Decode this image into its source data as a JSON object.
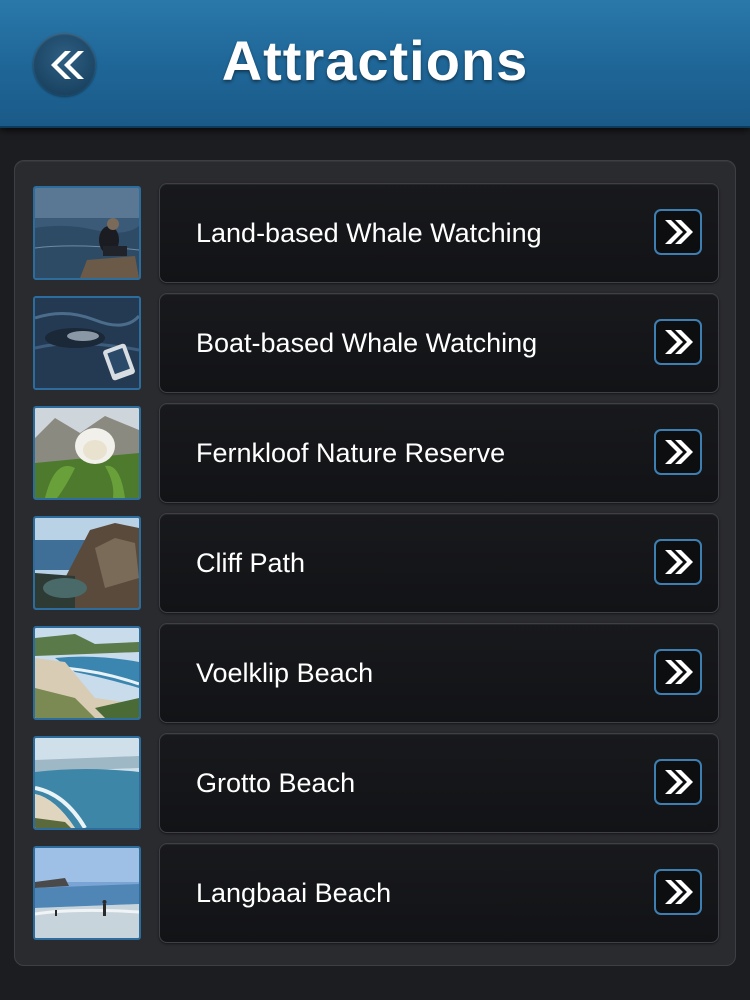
{
  "header": {
    "title": "Attractions",
    "back_icon": "double-chevron-left-icon"
  },
  "attractions": [
    {
      "label": "Land-based Whale Watching",
      "thumb": "person-on-rocks-ocean",
      "icon": "double-chevron-right-icon"
    },
    {
      "label": "Boat-based Whale Watching",
      "thumb": "whale-in-sea",
      "icon": "double-chevron-right-icon"
    },
    {
      "label": "Fernkloof Nature Reserve",
      "thumb": "protea-flower",
      "icon": "double-chevron-right-icon"
    },
    {
      "label": "Cliff Path",
      "thumb": "coastal-cliffs",
      "icon": "double-chevron-right-icon"
    },
    {
      "label": "Voelklip Beach",
      "thumb": "beach-with-dunes",
      "icon": "double-chevron-right-icon"
    },
    {
      "label": "Grotto Beach",
      "thumb": "long-beach-aerial",
      "icon": "double-chevron-right-icon"
    },
    {
      "label": "Langbaai Beach",
      "thumb": "beach-with-swimmers",
      "icon": "double-chevron-right-icon"
    }
  ],
  "colors": {
    "header": "#1f6798",
    "accent_border": "#3e7fb3",
    "background": "#1c1d20"
  }
}
